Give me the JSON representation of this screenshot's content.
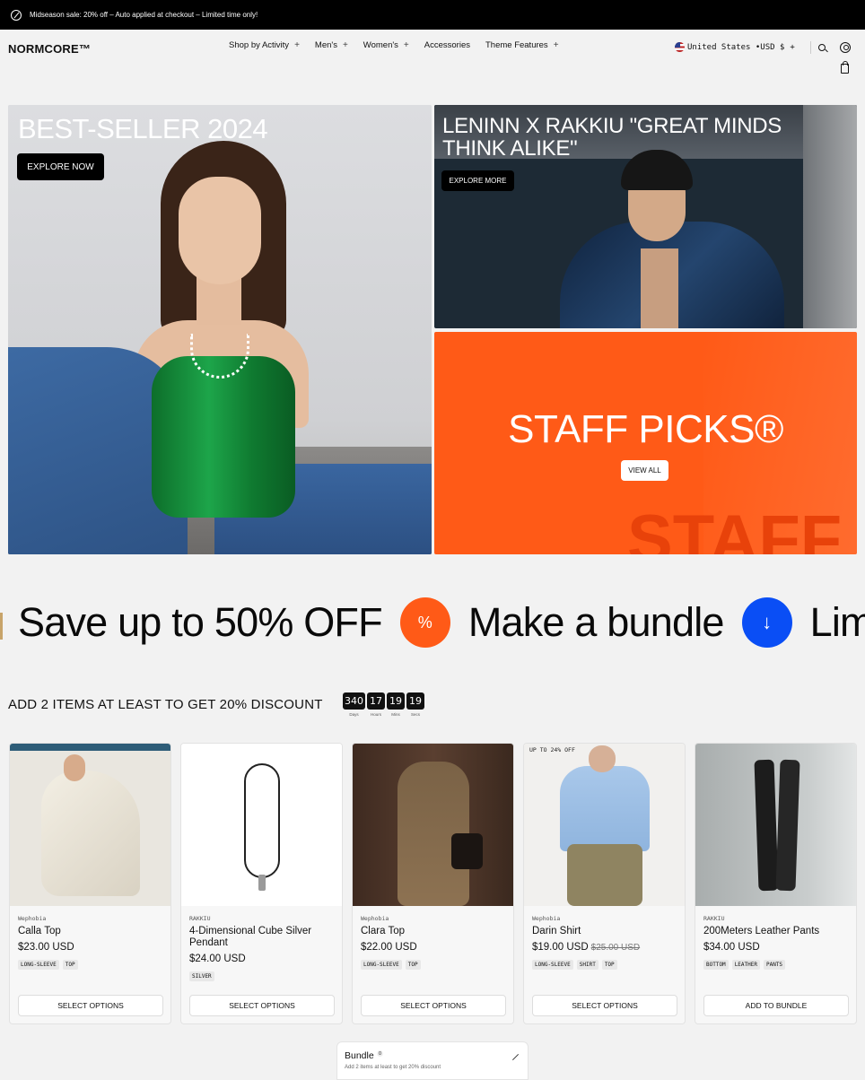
{
  "announcement": {
    "text": "Midseason sale: 20% off – Auto applied at checkout – Limited time only!"
  },
  "header": {
    "logo": "NORMCORE™",
    "nav": [
      {
        "label": "Shop by Activity",
        "has_submenu": true
      },
      {
        "label": "Men's",
        "has_submenu": true
      },
      {
        "label": "Women's",
        "has_submenu": true
      },
      {
        "label": "Accessories",
        "has_submenu": false
      },
      {
        "label": "Theme Features",
        "has_submenu": true
      }
    ],
    "plus": "+",
    "locale": "United States •USD $",
    "locale_plus": "+"
  },
  "hero": {
    "main": {
      "title": "BEST-SELLER 2024",
      "button": "EXPLORE NOW"
    },
    "top": {
      "title": "LENINN X RAKKIU \"GREAT MINDS THINK ALIKE\"",
      "button": "EXPLORE MORE"
    },
    "staff": {
      "title": "STAFF PICKS®",
      "bg_text": "STAFF",
      "button": "VIEW ALL",
      "color": "#ff5a17"
    }
  },
  "marquee": {
    "items": [
      "Save up to 50% OFF",
      "Make a bundle",
      "Lim"
    ],
    "icon1": "%",
    "icon2": "↓",
    "orange": "#ff5a17",
    "blue": "#0a4ef5"
  },
  "bundle": {
    "heading": "ADD 2 ITEMS AT LEAST TO GET 20% DISCOUNT",
    "countdown": [
      {
        "value": "340",
        "label": "Days"
      },
      {
        "value": "17",
        "label": "Hours"
      },
      {
        "value": "19",
        "label": "Mins"
      },
      {
        "value": "19",
        "label": "Secs"
      }
    ]
  },
  "products": [
    {
      "vendor": "Wephobia",
      "title": "Calla Top",
      "price": "$23.00 USD",
      "compare": "",
      "tags": [
        "LONG-SLEEVE",
        "TOP"
      ],
      "button": "SELECT OPTIONS",
      "badge": ""
    },
    {
      "vendor": "RAKKIU",
      "title": "4-Dimensional Cube Silver Pendant",
      "price": "$24.00 USD",
      "compare": "",
      "tags": [
        "SILVER"
      ],
      "button": "SELECT OPTIONS",
      "badge": ""
    },
    {
      "vendor": "Wephobia",
      "title": "Clara Top",
      "price": "$22.00 USD",
      "compare": "",
      "tags": [
        "LONG-SLEEVE",
        "TOP"
      ],
      "button": "SELECT OPTIONS",
      "badge": ""
    },
    {
      "vendor": "Wephobia",
      "title": "Darin Shirt",
      "price": "$19.00 USD",
      "compare": "$25.00 USD",
      "tags": [
        "LONG-SLEEVE",
        "SHIRT",
        "TOP"
      ],
      "button": "SELECT OPTIONS",
      "badge": "UP TO 24% OFF"
    },
    {
      "vendor": "RAKKIU",
      "title": "200Meters Leather Pants",
      "price": "$34.00 USD",
      "compare": "",
      "tags": [
        "BOTTOM",
        "LEATHER",
        "PANTS"
      ],
      "button": "ADD TO BUNDLE",
      "badge": ""
    }
  ],
  "bundle_widget": {
    "title": "Bundle",
    "count": "0",
    "subtitle": "Add 2 items at least to get 20% discount"
  }
}
